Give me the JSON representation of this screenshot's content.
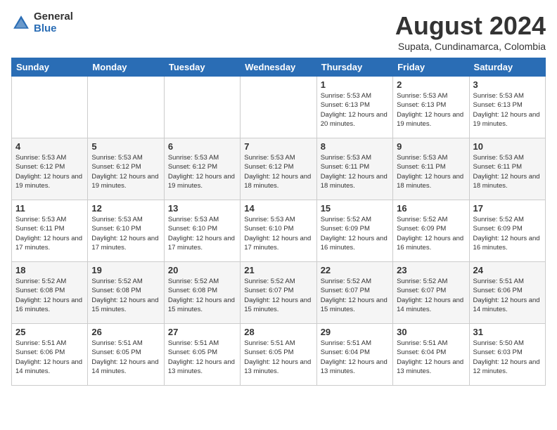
{
  "header": {
    "logo_general": "General",
    "logo_blue": "Blue",
    "month_year": "August 2024",
    "location": "Supata, Cundinamarca, Colombia"
  },
  "weekdays": [
    "Sunday",
    "Monday",
    "Tuesday",
    "Wednesday",
    "Thursday",
    "Friday",
    "Saturday"
  ],
  "weeks": [
    [
      {
        "day": "",
        "info": ""
      },
      {
        "day": "",
        "info": ""
      },
      {
        "day": "",
        "info": ""
      },
      {
        "day": "",
        "info": ""
      },
      {
        "day": "1",
        "info": "Sunrise: 5:53 AM\nSunset: 6:13 PM\nDaylight: 12 hours\nand 20 minutes."
      },
      {
        "day": "2",
        "info": "Sunrise: 5:53 AM\nSunset: 6:13 PM\nDaylight: 12 hours\nand 19 minutes."
      },
      {
        "day": "3",
        "info": "Sunrise: 5:53 AM\nSunset: 6:13 PM\nDaylight: 12 hours\nand 19 minutes."
      }
    ],
    [
      {
        "day": "4",
        "info": "Sunrise: 5:53 AM\nSunset: 6:12 PM\nDaylight: 12 hours\nand 19 minutes."
      },
      {
        "day": "5",
        "info": "Sunrise: 5:53 AM\nSunset: 6:12 PM\nDaylight: 12 hours\nand 19 minutes."
      },
      {
        "day": "6",
        "info": "Sunrise: 5:53 AM\nSunset: 6:12 PM\nDaylight: 12 hours\nand 19 minutes."
      },
      {
        "day": "7",
        "info": "Sunrise: 5:53 AM\nSunset: 6:12 PM\nDaylight: 12 hours\nand 18 minutes."
      },
      {
        "day": "8",
        "info": "Sunrise: 5:53 AM\nSunset: 6:11 PM\nDaylight: 12 hours\nand 18 minutes."
      },
      {
        "day": "9",
        "info": "Sunrise: 5:53 AM\nSunset: 6:11 PM\nDaylight: 12 hours\nand 18 minutes."
      },
      {
        "day": "10",
        "info": "Sunrise: 5:53 AM\nSunset: 6:11 PM\nDaylight: 12 hours\nand 18 minutes."
      }
    ],
    [
      {
        "day": "11",
        "info": "Sunrise: 5:53 AM\nSunset: 6:11 PM\nDaylight: 12 hours\nand 17 minutes."
      },
      {
        "day": "12",
        "info": "Sunrise: 5:53 AM\nSunset: 6:10 PM\nDaylight: 12 hours\nand 17 minutes."
      },
      {
        "day": "13",
        "info": "Sunrise: 5:53 AM\nSunset: 6:10 PM\nDaylight: 12 hours\nand 17 minutes."
      },
      {
        "day": "14",
        "info": "Sunrise: 5:53 AM\nSunset: 6:10 PM\nDaylight: 12 hours\nand 17 minutes."
      },
      {
        "day": "15",
        "info": "Sunrise: 5:52 AM\nSunset: 6:09 PM\nDaylight: 12 hours\nand 16 minutes."
      },
      {
        "day": "16",
        "info": "Sunrise: 5:52 AM\nSunset: 6:09 PM\nDaylight: 12 hours\nand 16 minutes."
      },
      {
        "day": "17",
        "info": "Sunrise: 5:52 AM\nSunset: 6:09 PM\nDaylight: 12 hours\nand 16 minutes."
      }
    ],
    [
      {
        "day": "18",
        "info": "Sunrise: 5:52 AM\nSunset: 6:08 PM\nDaylight: 12 hours\nand 16 minutes."
      },
      {
        "day": "19",
        "info": "Sunrise: 5:52 AM\nSunset: 6:08 PM\nDaylight: 12 hours\nand 15 minutes."
      },
      {
        "day": "20",
        "info": "Sunrise: 5:52 AM\nSunset: 6:08 PM\nDaylight: 12 hours\nand 15 minutes."
      },
      {
        "day": "21",
        "info": "Sunrise: 5:52 AM\nSunset: 6:07 PM\nDaylight: 12 hours\nand 15 minutes."
      },
      {
        "day": "22",
        "info": "Sunrise: 5:52 AM\nSunset: 6:07 PM\nDaylight: 12 hours\nand 15 minutes."
      },
      {
        "day": "23",
        "info": "Sunrise: 5:52 AM\nSunset: 6:07 PM\nDaylight: 12 hours\nand 14 minutes."
      },
      {
        "day": "24",
        "info": "Sunrise: 5:51 AM\nSunset: 6:06 PM\nDaylight: 12 hours\nand 14 minutes."
      }
    ],
    [
      {
        "day": "25",
        "info": "Sunrise: 5:51 AM\nSunset: 6:06 PM\nDaylight: 12 hours\nand 14 minutes."
      },
      {
        "day": "26",
        "info": "Sunrise: 5:51 AM\nSunset: 6:05 PM\nDaylight: 12 hours\nand 14 minutes."
      },
      {
        "day": "27",
        "info": "Sunrise: 5:51 AM\nSunset: 6:05 PM\nDaylight: 12 hours\nand 13 minutes."
      },
      {
        "day": "28",
        "info": "Sunrise: 5:51 AM\nSunset: 6:05 PM\nDaylight: 12 hours\nand 13 minutes."
      },
      {
        "day": "29",
        "info": "Sunrise: 5:51 AM\nSunset: 6:04 PM\nDaylight: 12 hours\nand 13 minutes."
      },
      {
        "day": "30",
        "info": "Sunrise: 5:51 AM\nSunset: 6:04 PM\nDaylight: 12 hours\nand 13 minutes."
      },
      {
        "day": "31",
        "info": "Sunrise: 5:50 AM\nSunset: 6:03 PM\nDaylight: 12 hours\nand 12 minutes."
      }
    ]
  ]
}
